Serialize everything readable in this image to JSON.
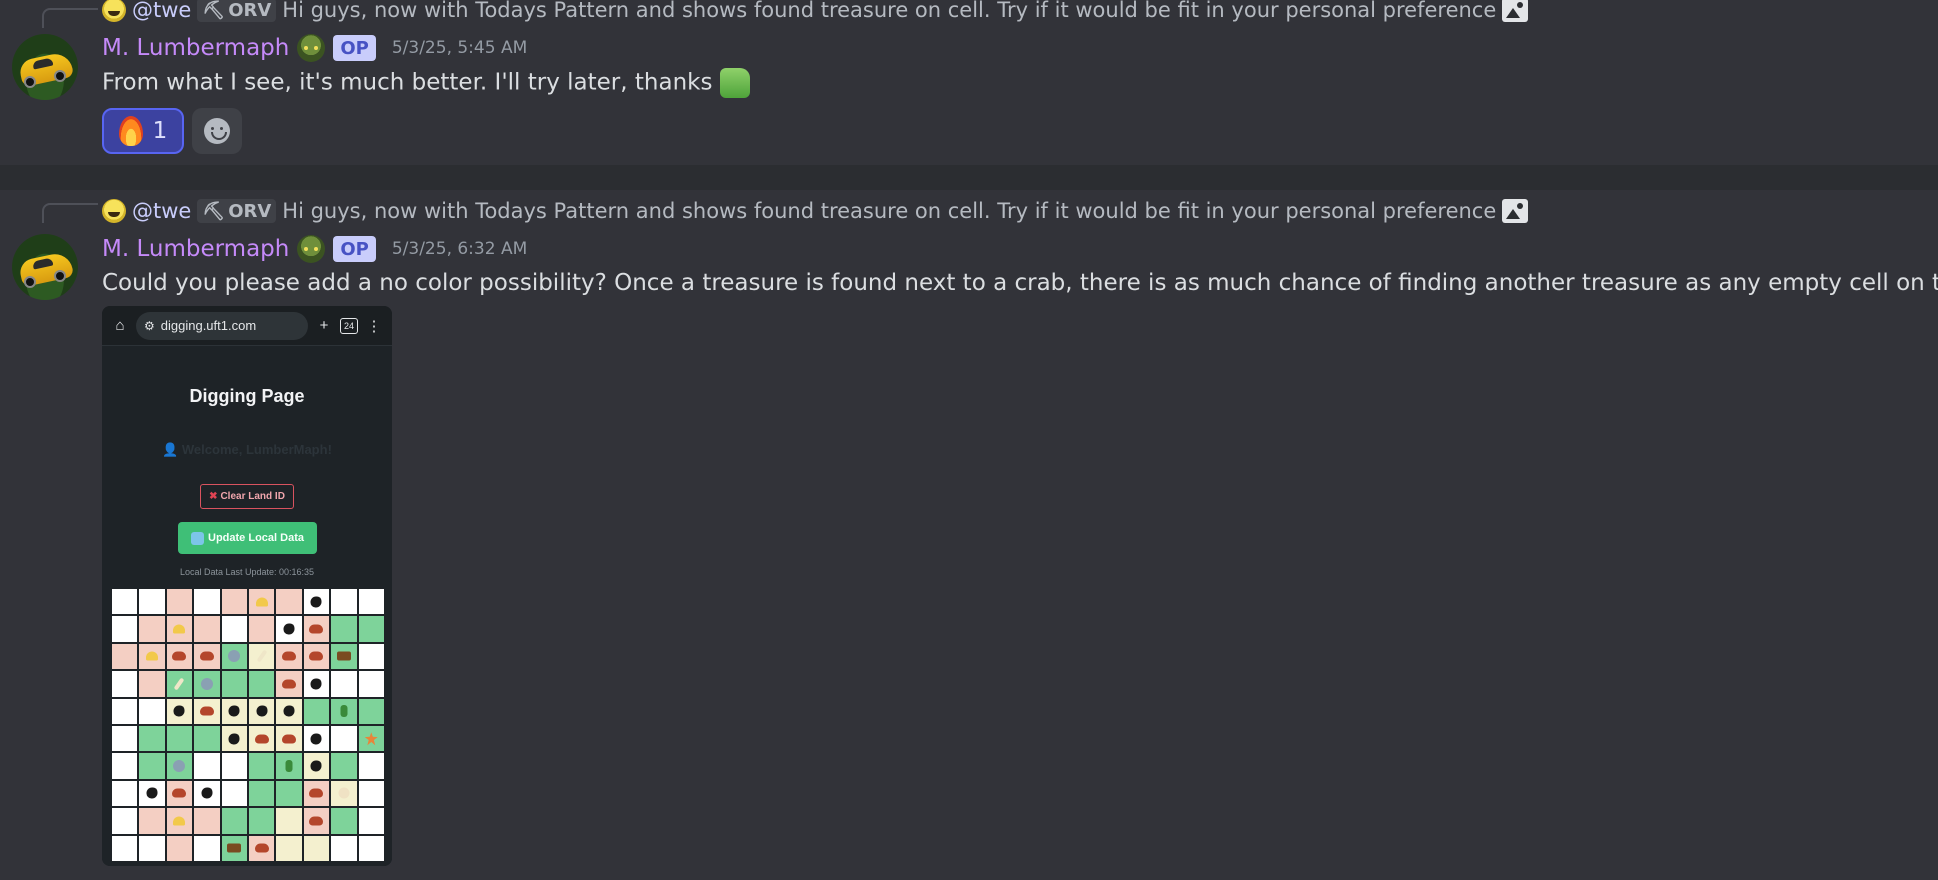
{
  "messages": [
    {
      "reply": {
        "mention": "@twe",
        "role": "ORV",
        "text": "Hi guys, now with Todays Pattern and shows found treasure on cell. Try if it would be fit in your personal preference"
      },
      "author": "M. Lumbermaph",
      "tag": "OP",
      "timestamp": "5/3/25, 5:45 AM",
      "content": "From what I see, it's much better. I'll try later, thanks",
      "reaction": {
        "emoji": "fire",
        "count": "1"
      }
    },
    {
      "reply": {
        "mention": "@twe",
        "role": "ORV",
        "text": "Hi guys, now with Todays Pattern and shows found treasure on cell. Try if it would be fit in your personal preference"
      },
      "author": "M. Lumbermaph",
      "tag": "OP",
      "timestamp": "5/3/25, 6:32 AM",
      "content": "Could you please add a no color possibility? Once a treasure is found next to a crab, there is as much chance of finding another treasure as any empty cell on the grid"
    }
  ],
  "attachment": {
    "url": "digging.uft1.com",
    "tab_count": "24",
    "page_title": "Digging Page",
    "welcome": "Welcome, LumberMaph!",
    "clear_button": "Clear Land ID",
    "update_button": "Update Local Data",
    "last_update": "Local Data Last Update: 00:16:35",
    "grid": [
      [
        "w",
        "w",
        "p",
        "w",
        "p",
        "p:shell",
        "p",
        "w:rock",
        "w",
        "w"
      ],
      [
        "w",
        "p",
        "p:shell",
        "p",
        "w",
        "p",
        "w:rock",
        "p:crab",
        "g",
        "g"
      ],
      [
        "p",
        "p:shell",
        "p:crab",
        "p:crab",
        "g:geo",
        "y:bone",
        "p:crab",
        "p:crab",
        "g:chest",
        "w"
      ],
      [
        "w",
        "p",
        "g:bone",
        "g:geo",
        "g",
        "g",
        "p:crab",
        "w:rock",
        "w",
        "w"
      ],
      [
        "w",
        "w",
        "y:rock",
        "y:crab",
        "y:rock",
        "y:rock",
        "y:rock",
        "g",
        "g:bottle",
        "g"
      ],
      [
        "w",
        "g",
        "g",
        "g",
        "y:rock",
        "y:crab",
        "y:crab",
        "w:rock",
        "w",
        "g:star"
      ],
      [
        "w",
        "g",
        "g:geo",
        "w",
        "w",
        "g",
        "g:bottle",
        "y:rock",
        "g",
        "w"
      ],
      [
        "w",
        "w:rock",
        "p:crab",
        "w:rock",
        "w",
        "g",
        "g",
        "p:crab",
        "y:pearl",
        "w"
      ],
      [
        "w",
        "p",
        "p:shell",
        "p",
        "g",
        "g",
        "y",
        "p:crab",
        "g",
        "w"
      ],
      [
        "w",
        "w",
        "p",
        "w",
        "g:chest",
        "p:crab",
        "y",
        "y",
        "w",
        "w"
      ]
    ]
  },
  "icons": {
    "reply_image": "image-icon",
    "home": "home-icon",
    "site_settings": "site-settings-icon",
    "new_tab": "plus-icon",
    "menu": "more-vertical-icon",
    "add_reaction": "add-reaction-icon"
  },
  "colors": {
    "background": "#323339",
    "username": "#c58af9",
    "op_tag_bg": "#c9cdfb",
    "reaction_bg": "#3c42a0",
    "update_btn": "#3fbf77",
    "clear_btn_border": "#d9535f"
  }
}
